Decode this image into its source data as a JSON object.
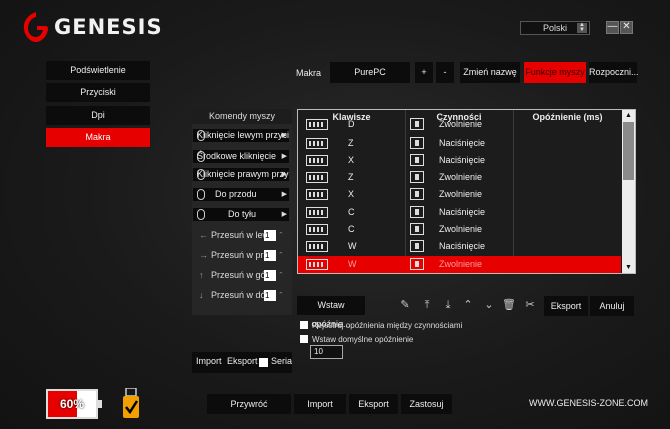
{
  "app": {
    "brand": "GENESIS",
    "language": "Polski",
    "minimize": "—",
    "close": "✕"
  },
  "sidebar": {
    "items": [
      {
        "label": "Podświetlenie"
      },
      {
        "label": "Przyciski"
      },
      {
        "label": "Dpi"
      },
      {
        "label": "Makra",
        "active": true
      }
    ]
  },
  "toolbar": {
    "macro_label": "Makra",
    "macro_name": "PurePC",
    "add": "+",
    "remove": "-",
    "rename": "Zmień nazwę",
    "mouse_functions": "Funkcje myszy",
    "start": "Rozpoczni..."
  },
  "commands": {
    "header": "Komendy myszy",
    "items": [
      {
        "label": "Kliknięcie lewym przycisk...",
        "icon": "mouse-icon"
      },
      {
        "label": "Środkowe kliknięcie",
        "icon": "mouse-icon"
      },
      {
        "label": "Kliknięcie prawym przycisk...",
        "icon": "mouse-icon"
      },
      {
        "label": "Do przodu",
        "icon": "mouse-icon"
      },
      {
        "label": "Do tyłu",
        "icon": "mouse-icon"
      }
    ],
    "scrolls": [
      {
        "label": "Przesuń w lewo",
        "value": "1",
        "arrow": "←"
      },
      {
        "label": "Przesuń w prawo",
        "value": "1",
        "arrow": "→"
      },
      {
        "label": "Przesuń w górę",
        "value": "1",
        "arrow": "↑"
      },
      {
        "label": "Przesuń w dół",
        "value": "1",
        "arrow": "↓"
      }
    ],
    "import": "Import",
    "export": "Eksport",
    "series": "Seria",
    "spin": "⌃"
  },
  "table": {
    "columns": [
      "Klawisze",
      "Czynności",
      "Opóźnienie (ms)"
    ],
    "rows": [
      {
        "key": "D",
        "action": "Zwolnienie"
      },
      {
        "key": "Z",
        "action": "Naciśnięcie"
      },
      {
        "key": "X",
        "action": "Naciśnięcie"
      },
      {
        "key": "Z",
        "action": "Zwolnienie"
      },
      {
        "key": "X",
        "action": "Zwolnienie"
      },
      {
        "key": "C",
        "action": "Naciśnięcie"
      },
      {
        "key": "C",
        "action": "Zwolnienie"
      },
      {
        "key": "W",
        "action": "Naciśnięcie"
      },
      {
        "key": "W",
        "action": "Zwolnienie",
        "selected": true
      }
    ]
  },
  "editor": {
    "insert_delay": "Wstaw opóźnie...",
    "export": "Eksport",
    "cancel": "Anuluj",
    "record_delays": "Rejestruj opóźnienia między czynnościami",
    "insert_default_delay": "Wstaw domyślne opóźnienie",
    "default_delay_value": "10"
  },
  "footer": {
    "restore": "Przywróć",
    "import": "Import",
    "export": "Eksport",
    "apply": "Zastosuj",
    "website": "WWW.GENESIS-ZONE.COM",
    "battery_percent": 60,
    "battery_label": "60%"
  },
  "colors": {
    "accent": "#e60000",
    "panel": "#0c0c0c"
  }
}
